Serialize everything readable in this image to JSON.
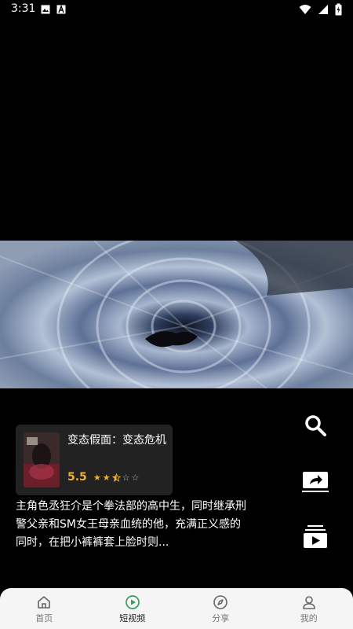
{
  "status": {
    "time": "3:31"
  },
  "movie": {
    "title": "变态假面：变态危机",
    "score": "5.5",
    "stars": 2.5,
    "description": "主角色丞狂介是个拳法部的高中生，同时继承刑警父亲和SM女王母亲血统的他，充满正义感的同时，在把小裤裤套上脸时则..."
  },
  "side_actions": [
    {
      "icon": "search-icon"
    },
    {
      "icon": "share-icon"
    },
    {
      "icon": "playlist-icon"
    }
  ],
  "tabs": [
    {
      "label": "首页",
      "icon": "home-icon",
      "active": false
    },
    {
      "label": "短视频",
      "icon": "play-circle-icon",
      "active": true
    },
    {
      "label": "分享",
      "icon": "compass-icon",
      "active": false
    },
    {
      "label": "我的",
      "icon": "person-icon",
      "active": false
    }
  ],
  "colors": {
    "accent": "#f0b030",
    "card": "#222222",
    "tabbar": "#f5f5f5"
  }
}
